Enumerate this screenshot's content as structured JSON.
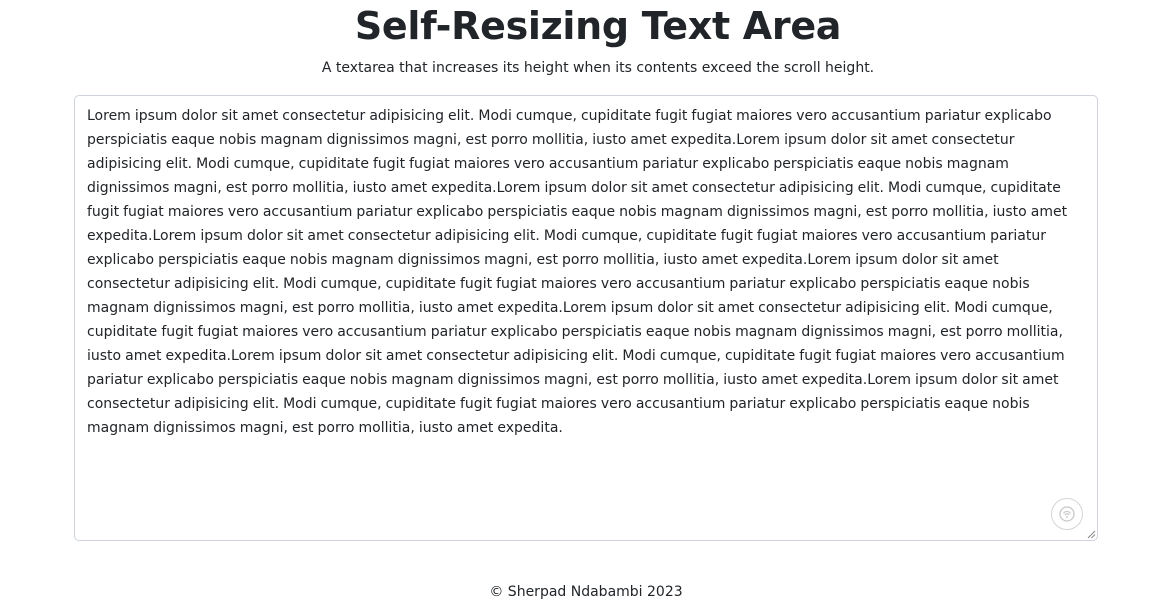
{
  "header": {
    "title": "Self-Resizing Text Area",
    "subtitle": "A textarea that increases its height when its contents exceed the scroll height."
  },
  "textarea": {
    "value": "Lorem ipsum dolor sit amet consectetur adipisicing elit. Modi cumque, cupiditate fugit fugiat maiores vero accusantium pariatur explicabo perspiciatis eaque nobis magnam dignissimos magni, est porro mollitia, iusto amet expedita.Lorem ipsum dolor sit amet consectetur adipisicing elit. Modi cumque, cupiditate fugit fugiat maiores vero accusantium pariatur explicabo perspiciatis eaque nobis magnam dignissimos magni, est porro mollitia, iusto amet expedita.Lorem ipsum dolor sit amet consectetur adipisicing elit. Modi cumque, cupiditate fugit fugiat maiores vero accusantium pariatur explicabo perspiciatis eaque nobis magnam dignissimos magni, est porro mollitia, iusto amet expedita.Lorem ipsum dolor sit amet consectetur adipisicing elit. Modi cumque, cupiditate fugit fugiat maiores vero accusantium pariatur explicabo perspiciatis eaque nobis magnam dignissimos magni, est porro mollitia, iusto amet expedita.Lorem ipsum dolor sit amet consectetur adipisicing elit. Modi cumque, cupiditate fugit fugiat maiores vero accusantium pariatur explicabo perspiciatis eaque nobis magnam dignissimos magni, est porro mollitia, iusto amet expedita.Lorem ipsum dolor sit amet consectetur adipisicing elit. Modi cumque, cupiditate fugit fugiat maiores vero accusantium pariatur explicabo perspiciatis eaque nobis magnam dignissimos magni, est porro mollitia, iusto amet expedita.Lorem ipsum dolor sit amet consectetur adipisicing elit. Modi cumque, cupiditate fugit fugiat maiores vero accusantium pariatur explicabo perspiciatis eaque nobis magnam dignissimos magni, est porro mollitia, iusto amet expedita.Lorem ipsum dolor sit amet consectetur adipisicing elit. Modi cumque, cupiditate fugit fugiat maiores vero accusantium pariatur explicabo perspiciatis eaque nobis magnam dignissimos magni, est porro mollitia, iusto amet expedita.",
    "overlay_icon": "grammarly-icon",
    "resize_icon": "resize-grip-icon"
  },
  "footer": {
    "copyright": "© Sherpad Ndabambi 2023"
  },
  "colors": {
    "text": "#212529",
    "border": "#ced4da",
    "background": "#ffffff"
  }
}
